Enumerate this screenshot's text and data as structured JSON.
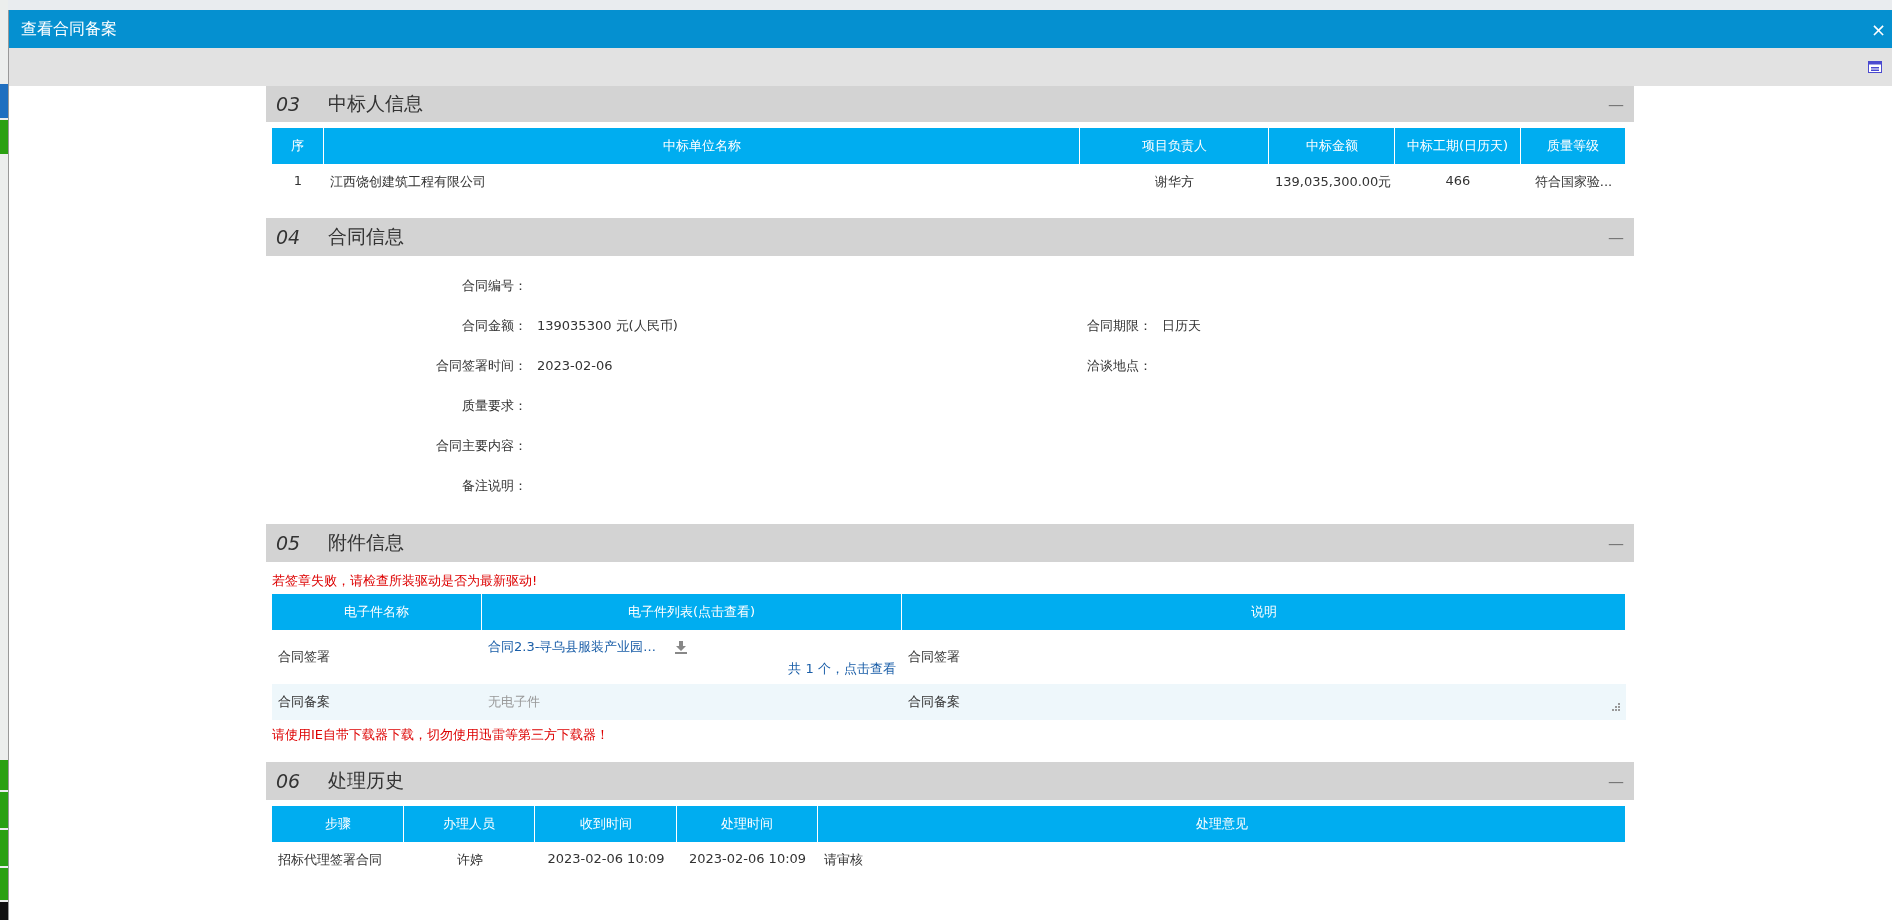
{
  "window": {
    "title": "查看合同备案",
    "close": "×"
  },
  "sections": [
    {
      "number": "03",
      "title": "中标人信息",
      "collapse": "—",
      "kind": "winners",
      "columns": [
        "序",
        "中标单位名称",
        "项目负责人",
        "中标金额",
        "中标工期(日历天)",
        "质量等级"
      ],
      "rows": [
        [
          "1",
          "江西饶创建筑工程有限公司",
          "谢华方",
          "139,035,300.00元",
          "466",
          "符合国家验..."
        ]
      ]
    },
    {
      "number": "04",
      "title": "合同信息",
      "collapse": "—",
      "kind": "form",
      "fields": [
        {
          "label": "合同编号："
        },
        {
          "label": "合同金额：",
          "value": "139035300 元(人民币)",
          "label2": "合同期限：",
          "value2": "日历天"
        },
        {
          "label": "合同签署时间：",
          "value": "2023-02-06",
          "label2": "洽谈地点："
        },
        {
          "label": "质量要求："
        },
        {
          "label": "合同主要内容："
        },
        {
          "label": "备注说明："
        }
      ]
    },
    {
      "number": "05",
      "title": "附件信息",
      "collapse": "—",
      "kind": "attachments",
      "warning": "若签章失败，请检查所装驱动是否为最新驱动!",
      "columns": [
        "电子件名称",
        "电子件列表(点击查看)",
        "说明"
      ],
      "rows": [
        {
          "name": "合同签署",
          "file": "合同2.3-寻乌县服装产业园...",
          "count": "共 1 个，点击查看",
          "note": "合同签署",
          "kind": "file"
        },
        {
          "name": "合同备案",
          "file": "无电子件",
          "note": "合同备案",
          "kind": "none"
        }
      ],
      "footer": "请使用IE自带下载器下载，切勿使用迅雷等第三方下载器！"
    },
    {
      "number": "06",
      "title": "处理历史",
      "collapse": "—",
      "kind": "history",
      "columns": [
        "步骤",
        "办理人员",
        "收到时间",
        "处理时间",
        "处理意见"
      ],
      "rows": [
        [
          "招标代理签署合同",
          "许婷",
          "2023-02-06 10:09",
          "2023-02-06 10:09",
          "请审核"
        ]
      ]
    }
  ]
}
